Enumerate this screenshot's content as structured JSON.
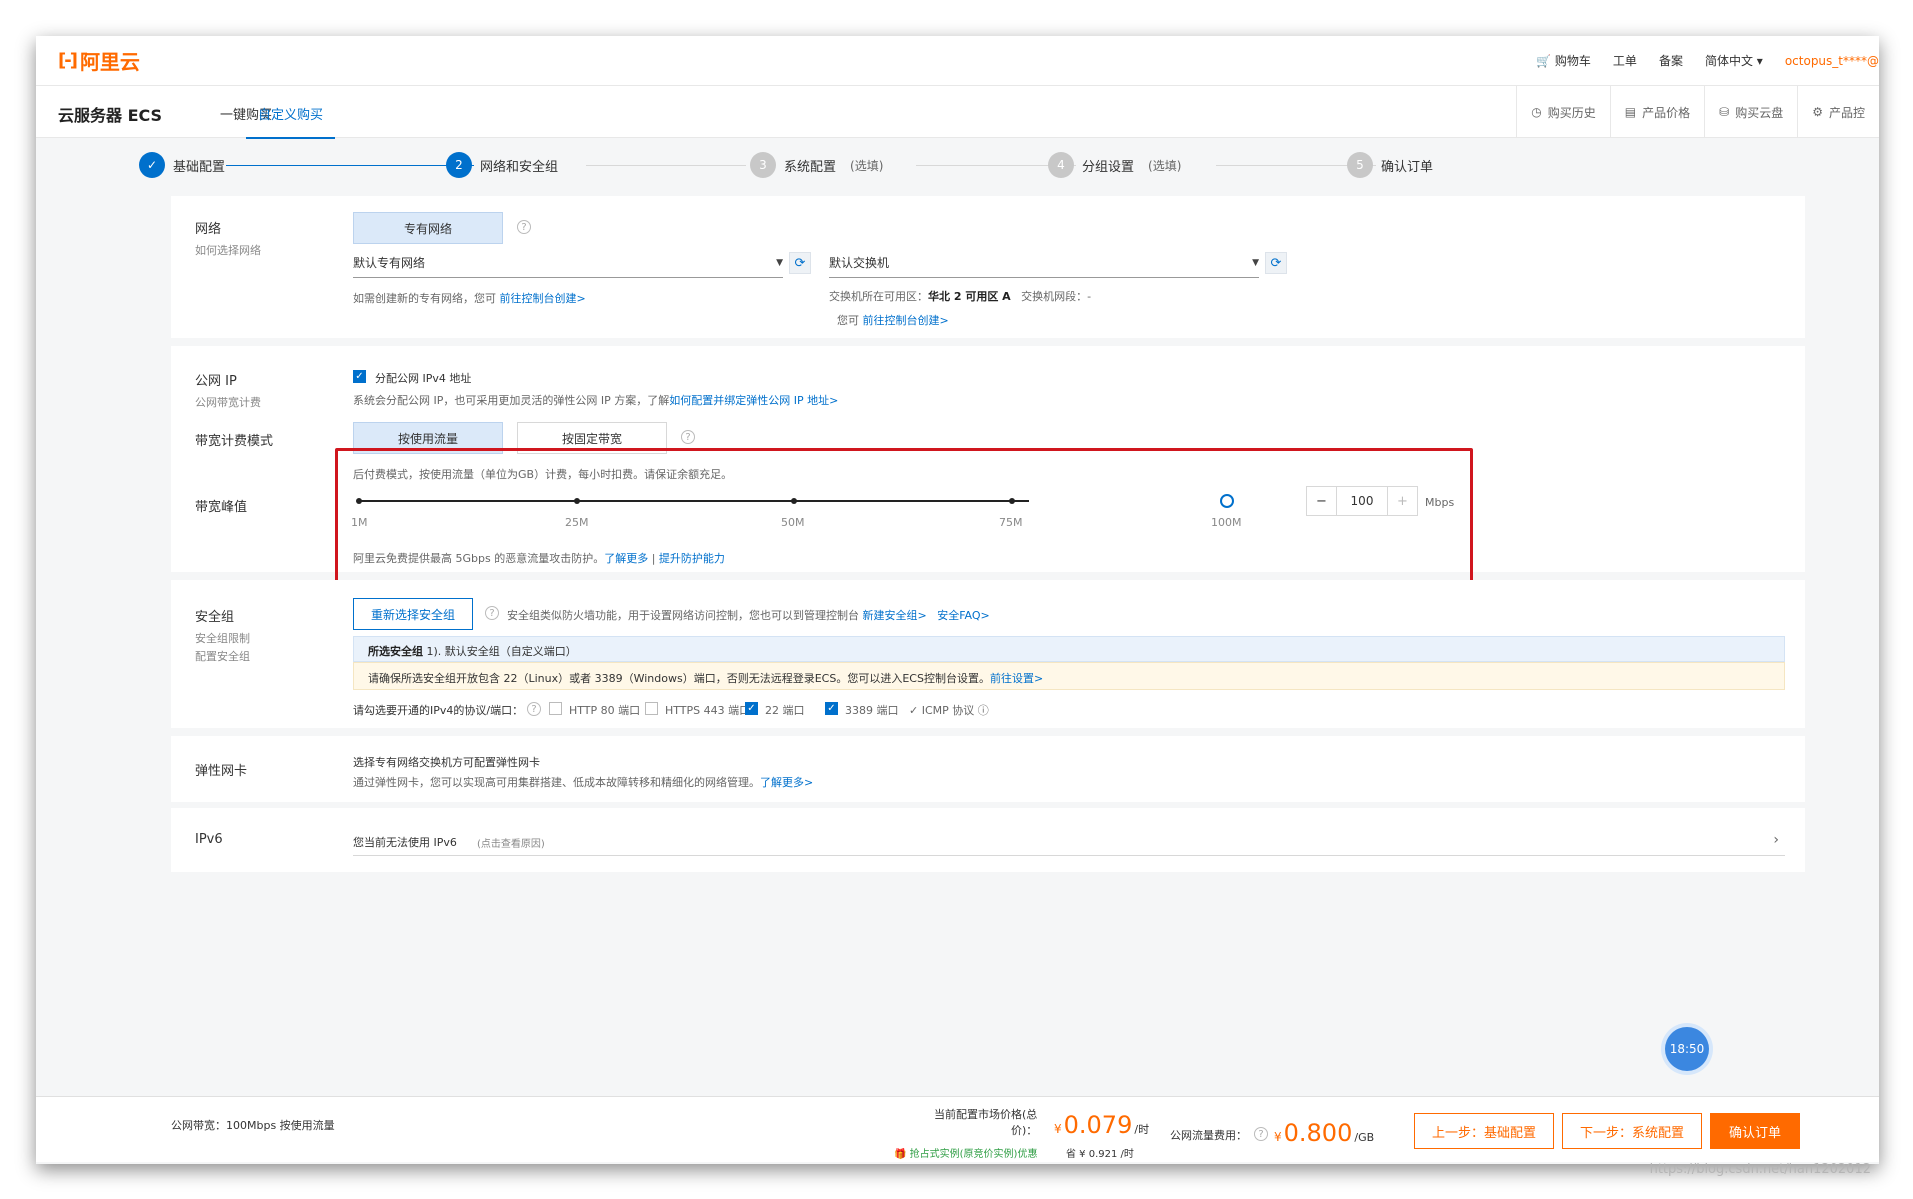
{
  "topbar": {
    "logo_text": "阿里云",
    "links": [
      "购物车",
      "工单",
      "备案",
      "简体中文"
    ],
    "user": "octopus_t****@"
  },
  "subbar": {
    "product": "云服务器 ECS",
    "tabs": [
      "一键购买",
      "自定义购买"
    ],
    "right_items": [
      "购买历史",
      "产品价格",
      "购买云盘",
      "产品控"
    ]
  },
  "steps": [
    {
      "num": "✓",
      "label": "基础配置",
      "opt": ""
    },
    {
      "num": "2",
      "label": "网络和安全组",
      "opt": ""
    },
    {
      "num": "3",
      "label": "系统配置",
      "opt": "(选填)"
    },
    {
      "num": "4",
      "label": "分组设置",
      "opt": "(选填)"
    },
    {
      "num": "5",
      "label": "确认订单",
      "opt": ""
    }
  ],
  "network": {
    "label": "网络",
    "sublabel": "如何选择网络",
    "type_btn": "专有网络",
    "vpc_select": "默认专有网络",
    "vswitch_select": "默认交换机",
    "vpc_hint_prefix": "如需创建新的专有网络，您可",
    "vpc_hint_link": "前往控制台创建>",
    "zone_prefix": "交换机所在可用区：",
    "zone_value": "华北 2 可用区 A",
    "cidr_label": "交换机网段：",
    "cidr_value": "-",
    "vswitch_hint_prefix": "您可",
    "vswitch_hint_link": "前往控制台创建>"
  },
  "public_ip": {
    "label": "公网 IP",
    "sublabel": "公网带宽计费",
    "checkbox_label": "分配公网 IPv4 地址",
    "desc_prefix": "系统会分配公网 IP，也可采用更加灵活的弹性公网 IP 方案，了解",
    "desc_link": "如何配置并绑定弹性公网 IP 地址>",
    "billing_label": "带宽计费模式",
    "billing_options": [
      "按使用流量",
      "按固定带宽"
    ],
    "billing_desc": "后付费模式，按使用流量（单位为GB）计费，每小时扣费。请保证余额充足。",
    "peak_label": "带宽峰值",
    "ticks": [
      "1M",
      "25M",
      "50M",
      "75M",
      "100M"
    ],
    "slider_value": 1.0,
    "bandwidth_value": "100",
    "unit": "Mbps",
    "minus": "−",
    "plus": "+",
    "ddos_prefix": "阿里云免费提供最高 5Gbps 的恶意流量攻击防护。",
    "ddos_link1": "了解更多",
    "ddos_sep": " | ",
    "ddos_link2": "提升防护能力"
  },
  "security": {
    "label": "安全组",
    "sublabels": [
      "安全组限制",
      "配置安全组"
    ],
    "reselect_btn": "重新选择安全组",
    "desc_prefix": "安全组类似防火墙功能，用于设置网络访问控制，您也可以到管理控制台",
    "desc_link1": "新建安全组>",
    "desc_link2": "安全FAQ>",
    "selected_label": "所选安全组",
    "selected_value": "1). 默认安全组（自定义端口）",
    "warn_prefix": "请确保所选安全组开放包含 22（Linux）或者 3389（Windows）端口，否则无法远程登录ECS。您可以进入ECS控制台设置。",
    "warn_link": "前往设置>",
    "ports_label": "请勾选要开通的IPv4的协议/端口：",
    "ports": [
      {
        "label": "HTTP 80 端口",
        "checked": false
      },
      {
        "label": "HTTPS 443 端口",
        "checked": false
      },
      {
        "label": "22 端口",
        "checked": true
      },
      {
        "label": "3389 端口",
        "checked": true
      }
    ],
    "icmp": "✓ ICMP 协议"
  },
  "eni": {
    "label": "弹性网卡",
    "title": "选择专有网络交换机方可配置弹性网卡",
    "desc_prefix": "通过弹性网卡，您可以实现高可用集群搭建、低成本故障转移和精细化的网络管理。",
    "desc_link": "了解更多>"
  },
  "ipv6": {
    "label": "IPv6",
    "text": "您当前无法使用 IPv6",
    "hint": "(点击查看原因)",
    "chevron": "›"
  },
  "clock": "18:50",
  "footer": {
    "bandwidth_summary": "公网带宽：100Mbps 按使用流量",
    "price_label_line1": "当前配置市场价格(总",
    "price_label_line2": "价)：",
    "currency": "¥",
    "price": "0.079",
    "price_unit": "/时",
    "spot_link": "抢占式实例(原竞价实例)优惠",
    "save_text": "省 ¥ 0.921 /时",
    "traffic_label": "公网流量费用：",
    "traffic_price": "0.800",
    "traffic_unit": "/GB",
    "prev_btn": "上一步：基础配置",
    "next_btn": "下一步：系统配置",
    "confirm_btn": "确认订单"
  },
  "watermark": "https://blog.csdn.net/han1202012",
  "colors": {
    "accent": "#0070cc",
    "brand": "#ff6a00",
    "highlight": "#d0161e"
  }
}
